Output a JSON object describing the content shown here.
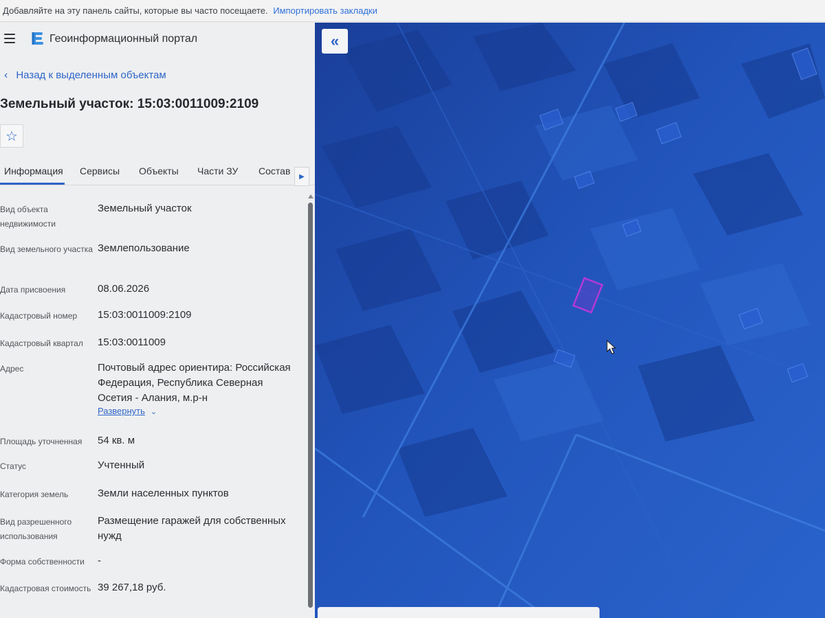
{
  "bookmarks_bar": {
    "text": "Добавляйте на эту панель сайты, которые вы часто посещаете.",
    "link": "Импортировать закладки"
  },
  "header": {
    "title": "Геоинформационный портал"
  },
  "back_link": "Назад к выделенным объектам",
  "object_title": "Земельный участок: 15:03:0011009:2109",
  "tabs": [
    "Информация",
    "Сервисы",
    "Объекты",
    "Части ЗУ",
    "Состав"
  ],
  "active_tab": "Информация",
  "properties": [
    {
      "label": "Вид объекта недвижимости",
      "value": "Земельный участок"
    },
    {
      "label": "Вид земельного участка",
      "value": "Землепользование"
    },
    {
      "label": "Дата присвоения",
      "value": "08.06.2026"
    },
    {
      "label": "Кадастровый номер",
      "value": "15:03:0011009:2109"
    },
    {
      "label": "Кадастровый квартал",
      "value": "15:03:0011009"
    },
    {
      "label": "Адрес",
      "value": "Почтовый адрес ориентира: Российская Федерация, Республика Северная Осетия - Алания, м.р-н"
    },
    {
      "label": "Площадь уточненная",
      "value": "54 кв. м"
    },
    {
      "label": "Статус",
      "value": "Учтенный"
    },
    {
      "label": "Категория земель",
      "value": "Земли населенных пунктов"
    },
    {
      "label": "Вид разрешенного использования",
      "value": "Размещение гаражей для собственных нужд"
    },
    {
      "label": "Форма собственности",
      "value": "-"
    },
    {
      "label": "Кадастровая стоимость",
      "value": "39 267,18 руб."
    }
  ],
  "expand_link": "Развернуть",
  "icons": {
    "menu": "hamburger-icon",
    "logo": "portal-logo-icon",
    "back": "chevron-left-icon",
    "favorite": "star-icon",
    "tabs_next": "chevron-right-icon",
    "collapse": "double-chevron-left-icon",
    "cursor": "mouse-cursor-icon"
  },
  "colors": {
    "accent": "#2f66c8",
    "map_base": "#1f4fb0",
    "parcel_highlight": "#b23ad6",
    "panel_bg": "#eeeff0"
  }
}
